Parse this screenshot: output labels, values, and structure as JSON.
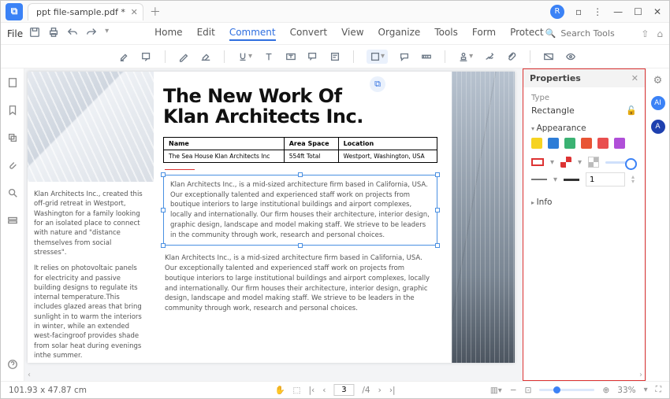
{
  "titlebar": {
    "tab_title": "ppt file-sample.pdf *",
    "avatar_initial": "R"
  },
  "menubar": {
    "file": "File",
    "items": [
      "Home",
      "Edit",
      "Comment",
      "Convert",
      "View",
      "Organize",
      "Tools",
      "Form",
      "Protect"
    ],
    "active_index": 2,
    "search_placeholder": "Search Tools"
  },
  "properties": {
    "title": "Properties",
    "type_label": "Type",
    "type_value": "Rectangle",
    "appearance_label": "Appearance",
    "info_label": "Info",
    "thickness_value": "1",
    "swatches": [
      "#f6d321",
      "#2e7dd7",
      "#3bb273",
      "#e85434",
      "#e94f4f",
      "#b04fd8"
    ]
  },
  "document": {
    "headline1": "The New Work Of",
    "headline2": "Klan Architects Inc.",
    "table": {
      "headers": [
        "Name",
        "Area Space",
        "Location"
      ],
      "cells": [
        "The Sea House Klan Architects Inc",
        "554ft Total",
        "Westport, Washington, USA"
      ]
    },
    "left_p1": "Klan Architects Inc., created this off-grid retreat in Westport, Washington for a family looking for an isolated place to connect with nature and \"distance themselves from social stresses\".",
    "left_p2": "It relies on photovoltaic panels for electricity and passive building designs to regulate its internal temperature.This includes glazed areas that bring sunlight in to warm the interiors in winter, while an extended west-facingroof provides shade from solar heat during evenings inthe summer.",
    "body": "Klan Architects Inc., is a mid-sized architecture firm based in California, USA. Our exceptionally talented and experienced staff work on projects from boutique interiors to large institutional buildings and airport complexes, locally and internationally. Our firm houses their architecture, interior design, graphic design, landscape and model making staff. We strieve to be leaders in the community through work, research and personal choices."
  },
  "status": {
    "coords": "101.93 x 47.87 cm",
    "page_current": "3",
    "page_total": "/4",
    "zoom": "33%"
  }
}
